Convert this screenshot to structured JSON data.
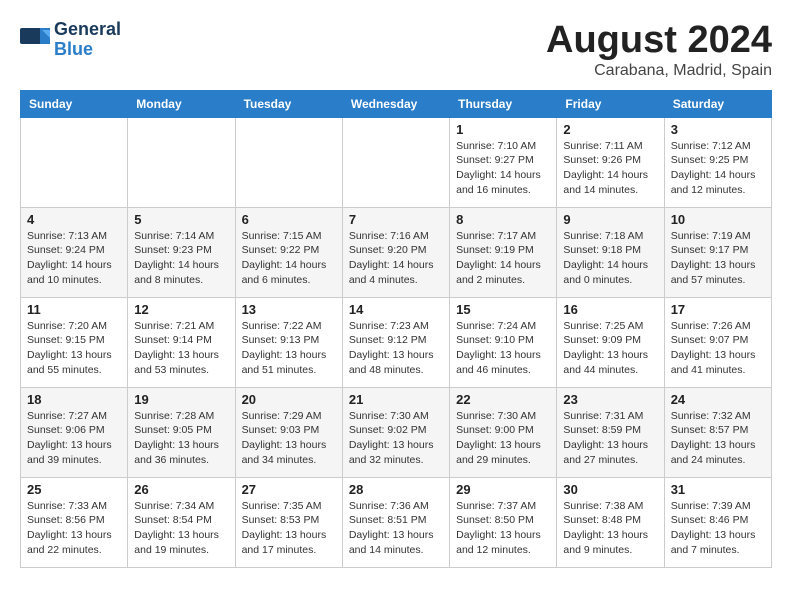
{
  "header": {
    "logo_general": "General",
    "logo_blue": "Blue",
    "month_title": "August 2024",
    "location": "Carabana, Madrid, Spain"
  },
  "days_of_week": [
    "Sunday",
    "Monday",
    "Tuesday",
    "Wednesday",
    "Thursday",
    "Friday",
    "Saturday"
  ],
  "weeks": [
    {
      "days": [
        {
          "number": "",
          "info": ""
        },
        {
          "number": "",
          "info": ""
        },
        {
          "number": "",
          "info": ""
        },
        {
          "number": "",
          "info": ""
        },
        {
          "number": "1",
          "info": "Sunrise: 7:10 AM\nSunset: 9:27 PM\nDaylight: 14 hours\nand 16 minutes."
        },
        {
          "number": "2",
          "info": "Sunrise: 7:11 AM\nSunset: 9:26 PM\nDaylight: 14 hours\nand 14 minutes."
        },
        {
          "number": "3",
          "info": "Sunrise: 7:12 AM\nSunset: 9:25 PM\nDaylight: 14 hours\nand 12 minutes."
        }
      ]
    },
    {
      "days": [
        {
          "number": "4",
          "info": "Sunrise: 7:13 AM\nSunset: 9:24 PM\nDaylight: 14 hours\nand 10 minutes."
        },
        {
          "number": "5",
          "info": "Sunrise: 7:14 AM\nSunset: 9:23 PM\nDaylight: 14 hours\nand 8 minutes."
        },
        {
          "number": "6",
          "info": "Sunrise: 7:15 AM\nSunset: 9:22 PM\nDaylight: 14 hours\nand 6 minutes."
        },
        {
          "number": "7",
          "info": "Sunrise: 7:16 AM\nSunset: 9:20 PM\nDaylight: 14 hours\nand 4 minutes."
        },
        {
          "number": "8",
          "info": "Sunrise: 7:17 AM\nSunset: 9:19 PM\nDaylight: 14 hours\nand 2 minutes."
        },
        {
          "number": "9",
          "info": "Sunrise: 7:18 AM\nSunset: 9:18 PM\nDaylight: 14 hours\nand 0 minutes."
        },
        {
          "number": "10",
          "info": "Sunrise: 7:19 AM\nSunset: 9:17 PM\nDaylight: 13 hours\nand 57 minutes."
        }
      ]
    },
    {
      "days": [
        {
          "number": "11",
          "info": "Sunrise: 7:20 AM\nSunset: 9:15 PM\nDaylight: 13 hours\nand 55 minutes."
        },
        {
          "number": "12",
          "info": "Sunrise: 7:21 AM\nSunset: 9:14 PM\nDaylight: 13 hours\nand 53 minutes."
        },
        {
          "number": "13",
          "info": "Sunrise: 7:22 AM\nSunset: 9:13 PM\nDaylight: 13 hours\nand 51 minutes."
        },
        {
          "number": "14",
          "info": "Sunrise: 7:23 AM\nSunset: 9:12 PM\nDaylight: 13 hours\nand 48 minutes."
        },
        {
          "number": "15",
          "info": "Sunrise: 7:24 AM\nSunset: 9:10 PM\nDaylight: 13 hours\nand 46 minutes."
        },
        {
          "number": "16",
          "info": "Sunrise: 7:25 AM\nSunset: 9:09 PM\nDaylight: 13 hours\nand 44 minutes."
        },
        {
          "number": "17",
          "info": "Sunrise: 7:26 AM\nSunset: 9:07 PM\nDaylight: 13 hours\nand 41 minutes."
        }
      ]
    },
    {
      "days": [
        {
          "number": "18",
          "info": "Sunrise: 7:27 AM\nSunset: 9:06 PM\nDaylight: 13 hours\nand 39 minutes."
        },
        {
          "number": "19",
          "info": "Sunrise: 7:28 AM\nSunset: 9:05 PM\nDaylight: 13 hours\nand 36 minutes."
        },
        {
          "number": "20",
          "info": "Sunrise: 7:29 AM\nSunset: 9:03 PM\nDaylight: 13 hours\nand 34 minutes."
        },
        {
          "number": "21",
          "info": "Sunrise: 7:30 AM\nSunset: 9:02 PM\nDaylight: 13 hours\nand 32 minutes."
        },
        {
          "number": "22",
          "info": "Sunrise: 7:30 AM\nSunset: 9:00 PM\nDaylight: 13 hours\nand 29 minutes."
        },
        {
          "number": "23",
          "info": "Sunrise: 7:31 AM\nSunset: 8:59 PM\nDaylight: 13 hours\nand 27 minutes."
        },
        {
          "number": "24",
          "info": "Sunrise: 7:32 AM\nSunset: 8:57 PM\nDaylight: 13 hours\nand 24 minutes."
        }
      ]
    },
    {
      "days": [
        {
          "number": "25",
          "info": "Sunrise: 7:33 AM\nSunset: 8:56 PM\nDaylight: 13 hours\nand 22 minutes."
        },
        {
          "number": "26",
          "info": "Sunrise: 7:34 AM\nSunset: 8:54 PM\nDaylight: 13 hours\nand 19 minutes."
        },
        {
          "number": "27",
          "info": "Sunrise: 7:35 AM\nSunset: 8:53 PM\nDaylight: 13 hours\nand 17 minutes."
        },
        {
          "number": "28",
          "info": "Sunrise: 7:36 AM\nSunset: 8:51 PM\nDaylight: 13 hours\nand 14 minutes."
        },
        {
          "number": "29",
          "info": "Sunrise: 7:37 AM\nSunset: 8:50 PM\nDaylight: 13 hours\nand 12 minutes."
        },
        {
          "number": "30",
          "info": "Sunrise: 7:38 AM\nSunset: 8:48 PM\nDaylight: 13 hours\nand 9 minutes."
        },
        {
          "number": "31",
          "info": "Sunrise: 7:39 AM\nSunset: 8:46 PM\nDaylight: 13 hours\nand 7 minutes."
        }
      ]
    }
  ]
}
